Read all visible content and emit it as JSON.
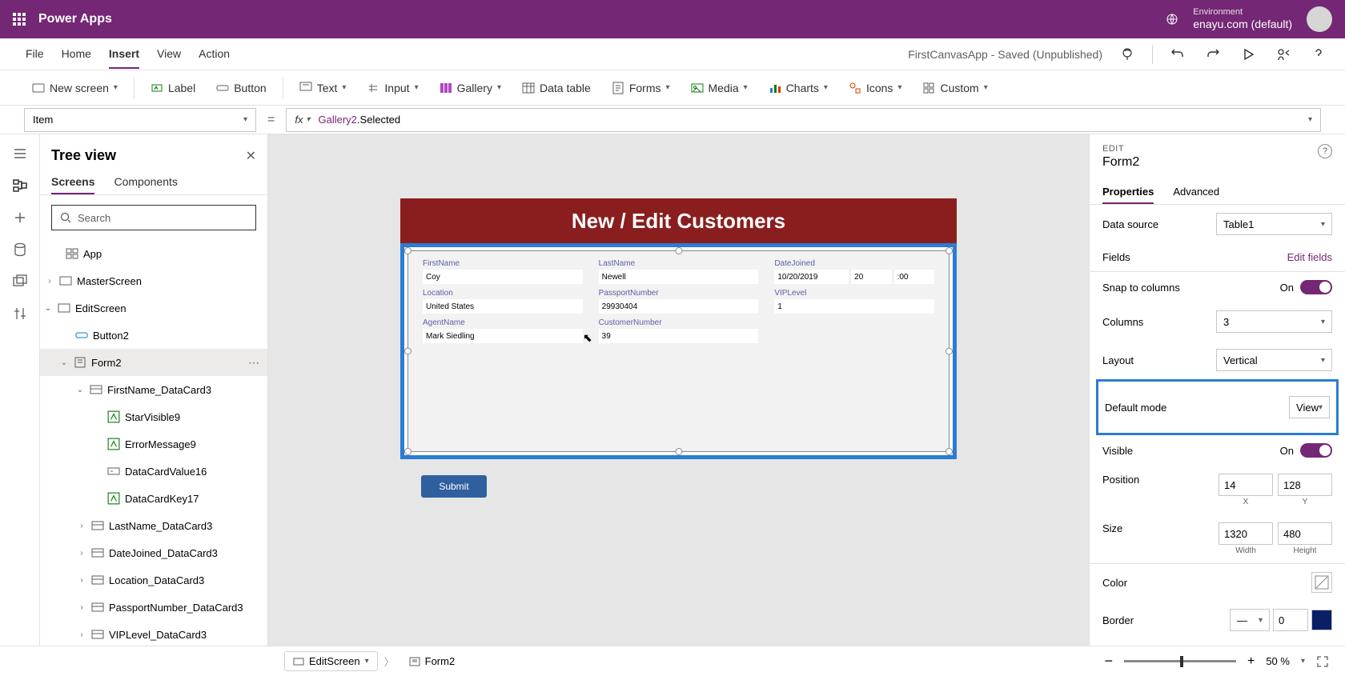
{
  "topbar": {
    "title": "Power Apps",
    "env_label": "Environment",
    "env_name": "enayu.com (default)"
  },
  "menu": {
    "items": [
      "File",
      "Home",
      "Insert",
      "View",
      "Action"
    ],
    "active": "Insert",
    "app_status": "FirstCanvasApp - Saved (Unpublished)"
  },
  "ribbon": {
    "new_screen": "New screen",
    "label": "Label",
    "button": "Button",
    "text": "Text",
    "input": "Input",
    "gallery": "Gallery",
    "datatable": "Data table",
    "forms": "Forms",
    "media": "Media",
    "charts": "Charts",
    "icons": "Icons",
    "custom": "Custom"
  },
  "formula": {
    "prop": "Item",
    "prefix": "Gallery2",
    "suffix": ".Selected"
  },
  "tree": {
    "title": "Tree view",
    "tabs": {
      "screens": "Screens",
      "components": "Components"
    },
    "search_placeholder": "Search",
    "nodes": {
      "app": "App",
      "master": "MasterScreen",
      "edit": "EditScreen",
      "button2": "Button2",
      "form2": "Form2",
      "firstname_dc": "FirstName_DataCard3",
      "starvisible": "StarVisible9",
      "errormsg": "ErrorMessage9",
      "dcv": "DataCardValue16",
      "dck": "DataCardKey17",
      "lastname_dc": "LastName_DataCard3",
      "datejoined_dc": "DateJoined_DataCard3",
      "location_dc": "Location_DataCard3",
      "passport_dc": "PassportNumber_DataCard3",
      "vip_dc": "VIPLevel_DataCard3"
    }
  },
  "canvas": {
    "title": "New / Edit Customers",
    "fields": {
      "firstname_l": "FirstName",
      "firstname_v": "Coy",
      "lastname_l": "LastName",
      "lastname_v": "Newell",
      "datejoined_l": "DateJoined",
      "datejoined_v1": "10/20/2019",
      "datejoined_v2": "20",
      "datejoined_v3": ":00",
      "location_l": "Location",
      "location_v": "United States",
      "passport_l": "PassportNumber",
      "passport_v": "29930404",
      "vip_l": "VIPLevel",
      "vip_v": "1",
      "agent_l": "AgentName",
      "agent_v": "Mark Siedling",
      "custnum_l": "CustomerNumber",
      "custnum_v": "39"
    },
    "submit": "Submit"
  },
  "props": {
    "edit_label": "EDIT",
    "name": "Form2",
    "tabs": {
      "properties": "Properties",
      "advanced": "Advanced"
    },
    "datasource_l": "Data source",
    "datasource_v": "Table1",
    "fields_l": "Fields",
    "edit_fields": "Edit fields",
    "snap_l": "Snap to columns",
    "snap_v": "On",
    "columns_l": "Columns",
    "columns_v": "3",
    "layout_l": "Layout",
    "layout_v": "Vertical",
    "defaultmode_l": "Default mode",
    "defaultmode_v": "View",
    "visible_l": "Visible",
    "visible_v": "On",
    "position_l": "Position",
    "pos_x": "14",
    "pos_y": "128",
    "pos_xl": "X",
    "pos_yl": "Y",
    "size_l": "Size",
    "size_w": "1320",
    "size_h": "480",
    "size_wl": "Width",
    "size_hl": "Height",
    "color_l": "Color",
    "border_l": "Border",
    "border_w": "0"
  },
  "status": {
    "bc_editscreen": "EditScreen",
    "bc_form2": "Form2",
    "zoom_minus": "−",
    "zoom_plus": "+",
    "zoom_pct": "50",
    "zoom_unit": "%"
  }
}
